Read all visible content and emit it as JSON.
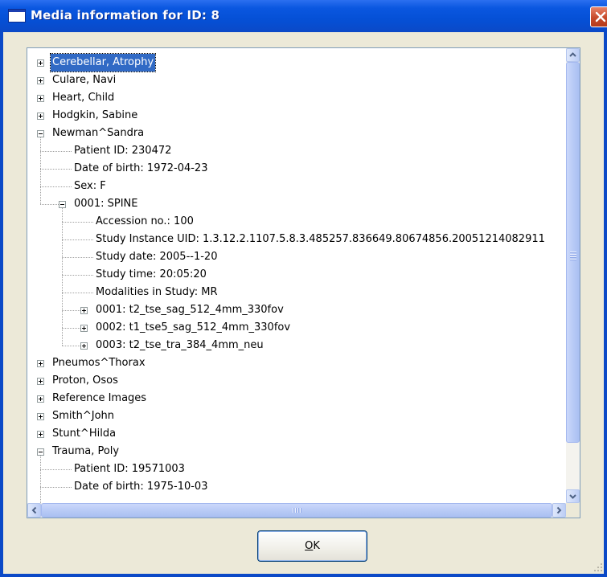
{
  "window": {
    "title": "Media information for ID: 8",
    "close_icon": "close-icon",
    "title_icon": "window-icon"
  },
  "tree": {
    "rows": [
      {
        "label": "Cerebellar, Atrophy",
        "level": 0,
        "expander": "plus",
        "selected": true
      },
      {
        "label": "Culare, Navi",
        "level": 0,
        "expander": "plus"
      },
      {
        "label": "Heart, Child",
        "level": 0,
        "expander": "plus"
      },
      {
        "label": "Hodgkin, Sabine",
        "level": 0,
        "expander": "plus"
      },
      {
        "label": "Newman^Sandra",
        "level": 0,
        "expander": "minus"
      },
      {
        "label": "Patient ID: 230472",
        "level": 1,
        "expander": "none"
      },
      {
        "label": "Date of birth: 1972-04-23",
        "level": 1,
        "expander": "none"
      },
      {
        "label": "Sex: F",
        "level": 1,
        "expander": "none"
      },
      {
        "label": "0001: SPINE",
        "level": 1,
        "expander": "minus"
      },
      {
        "label": "Accession no.: 100",
        "level": 2,
        "expander": "none"
      },
      {
        "label": "Study Instance UID: 1.3.12.2.1107.5.8.3.485257.836649.80674856.20051214082911",
        "level": 2,
        "expander": "none"
      },
      {
        "label": "Study date: 2005--1-20",
        "level": 2,
        "expander": "none"
      },
      {
        "label": "Study time: 20:05:20",
        "level": 2,
        "expander": "none"
      },
      {
        "label": "Modalities in Study: MR",
        "level": 2,
        "expander": "none"
      },
      {
        "label": "0001: t2_tse_sag_512_4mm_330fov",
        "level": 2,
        "expander": "plus"
      },
      {
        "label": "0002: t1_tse5_sag_512_4mm_330fov",
        "level": 2,
        "expander": "plus"
      },
      {
        "label": "0003: t2_tse_tra_384_4mm_neu",
        "level": 2,
        "expander": "plus"
      },
      {
        "label": "Pneumos^Thorax",
        "level": 0,
        "expander": "plus"
      },
      {
        "label": "Proton, Osos",
        "level": 0,
        "expander": "plus"
      },
      {
        "label": "Reference Images",
        "level": 0,
        "expander": "plus"
      },
      {
        "label": "Smith^John",
        "level": 0,
        "expander": "plus"
      },
      {
        "label": "Stunt^Hilda",
        "level": 0,
        "expander": "plus"
      },
      {
        "label": "Trauma, Poly",
        "level": 0,
        "expander": "minus"
      },
      {
        "label": "Patient ID: 19571003",
        "level": 1,
        "expander": "none"
      },
      {
        "label": "Date of birth: 1975-10-03",
        "level": 1,
        "expander": "none"
      }
    ],
    "vertical_scroll": {
      "up_icon": "scroll-up-arrow-icon",
      "down_icon": "scroll-down-arrow-icon"
    },
    "horizontal_scroll": {
      "left_icon": "scroll-left-arrow-icon",
      "right_icon": "scroll-right-arrow-icon"
    }
  },
  "buttons": {
    "ok_mnemonic": "O",
    "ok_rest": "K"
  },
  "colors": {
    "titlebar": "#0550d6",
    "selection": "#316ac5",
    "close": "#c64a2a"
  }
}
